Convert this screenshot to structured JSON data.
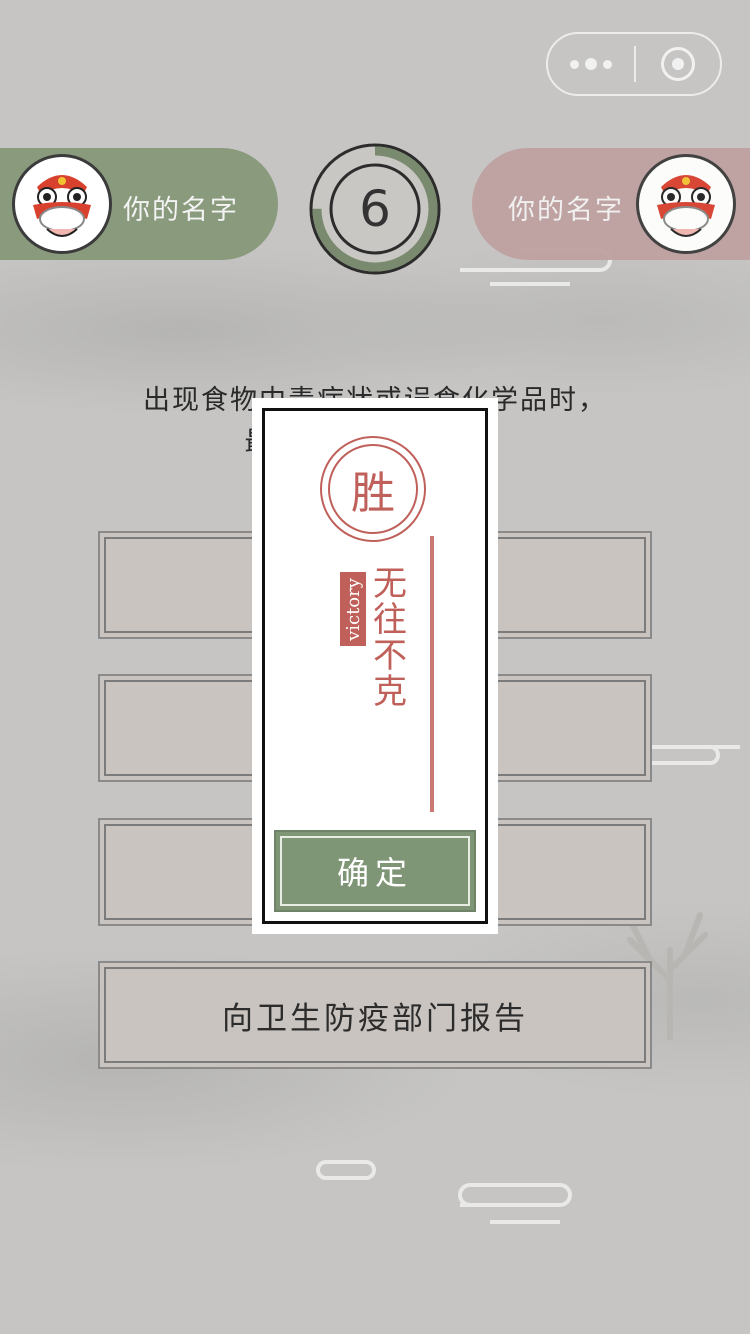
{
  "capsule": {
    "more_icon": "more-dots-icon",
    "close_icon": "mini-program-close-icon"
  },
  "players": {
    "left": {
      "name": "你的名字",
      "color": "#8a9a7d",
      "avatar_icon": "lion-dance-avatar-icon"
    },
    "right": {
      "name": "你的名字",
      "color": "#bfa1a1",
      "avatar_icon": "lion-dance-avatar-icon"
    }
  },
  "timer": {
    "value": "6",
    "progress": 0.75,
    "color": "#7a8a6e"
  },
  "question": {
    "line1": "出现食物中毒症状或误食化学品时，",
    "line2": "最先应该做的事是？"
  },
  "options": [
    {
      "label": ""
    },
    {
      "label": ""
    },
    {
      "label": ""
    },
    {
      "label": "向卫生防疫部门报告"
    }
  ],
  "modal": {
    "seal_char": "胜",
    "tag": "victory",
    "motto": [
      "无",
      "往",
      "不",
      "克"
    ],
    "confirm_label": "确定",
    "accent_color": "#c0605a",
    "button_color": "#7f9676"
  }
}
